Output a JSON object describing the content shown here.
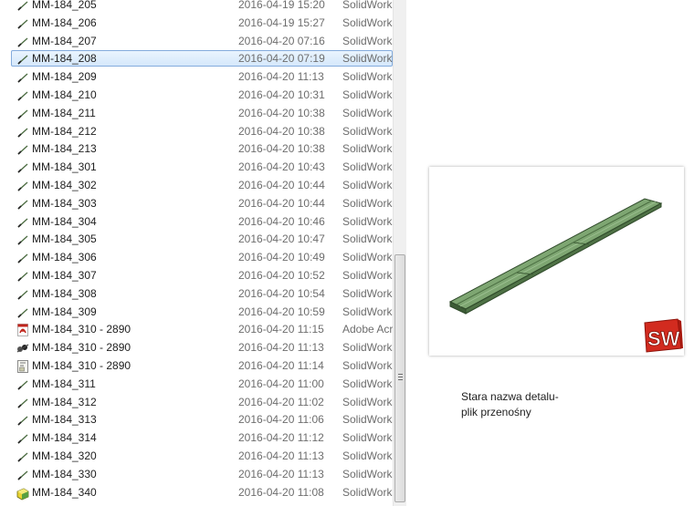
{
  "files": [
    {
      "name": "MM-184_205",
      "date": "2016-04-19 15:20",
      "type": "SolidWorks",
      "icon": "solidworks-part-icon"
    },
    {
      "name": "MM-184_206",
      "date": "2016-04-19 15:27",
      "type": "SolidWorks",
      "icon": "solidworks-part-icon"
    },
    {
      "name": "MM-184_207",
      "date": "2016-04-20 07:16",
      "type": "SolidWorks",
      "icon": "solidworks-part-icon"
    },
    {
      "name": "MM-184_208",
      "date": "2016-04-20 07:19",
      "type": "SolidWorks",
      "icon": "solidworks-part-icon",
      "selected": true
    },
    {
      "name": "MM-184_209",
      "date": "2016-04-20 11:13",
      "type": "SolidWorks",
      "icon": "solidworks-part-icon"
    },
    {
      "name": "MM-184_210",
      "date": "2016-04-20 10:31",
      "type": "SolidWorks",
      "icon": "solidworks-part-icon"
    },
    {
      "name": "MM-184_211",
      "date": "2016-04-20 10:38",
      "type": "SolidWorks",
      "icon": "solidworks-part-icon"
    },
    {
      "name": "MM-184_212",
      "date": "2016-04-20 10:38",
      "type": "SolidWorks",
      "icon": "solidworks-part-icon"
    },
    {
      "name": "MM-184_213",
      "date": "2016-04-20 10:38",
      "type": "SolidWorks",
      "icon": "solidworks-part-icon"
    },
    {
      "name": "MM-184_301",
      "date": "2016-04-20 10:43",
      "type": "SolidWorks",
      "icon": "solidworks-part-icon"
    },
    {
      "name": "MM-184_302",
      "date": "2016-04-20 10:44",
      "type": "SolidWorks",
      "icon": "solidworks-part-icon"
    },
    {
      "name": "MM-184_303",
      "date": "2016-04-20 10:44",
      "type": "SolidWorks",
      "icon": "solidworks-part-icon"
    },
    {
      "name": "MM-184_304",
      "date": "2016-04-20 10:46",
      "type": "SolidWorks",
      "icon": "solidworks-part-icon"
    },
    {
      "name": "MM-184_305",
      "date": "2016-04-20 10:47",
      "type": "SolidWorks",
      "icon": "solidworks-part-icon"
    },
    {
      "name": "MM-184_306",
      "date": "2016-04-20 10:49",
      "type": "SolidWorks",
      "icon": "solidworks-part-icon"
    },
    {
      "name": "MM-184_307",
      "date": "2016-04-20 10:52",
      "type": "SolidWorks",
      "icon": "solidworks-part-icon"
    },
    {
      "name": "MM-184_308",
      "date": "2016-04-20 10:54",
      "type": "SolidWorks",
      "icon": "solidworks-part-icon"
    },
    {
      "name": "MM-184_309",
      "date": "2016-04-20 10:59",
      "type": "SolidWorks",
      "icon": "solidworks-part-icon"
    },
    {
      "name": "MM-184_310 - 2890",
      "date": "2016-04-20 11:15",
      "type": "Adobe Acrobat",
      "icon": "pdf-icon"
    },
    {
      "name": "MM-184_310 - 2890",
      "date": "2016-04-20 11:13",
      "type": "SolidWorks",
      "icon": "solidworks-assembly-icon"
    },
    {
      "name": "MM-184_310 - 2890",
      "date": "2016-04-20 11:14",
      "type": "SolidWorks",
      "icon": "solidworks-drawing-icon"
    },
    {
      "name": "MM-184_311",
      "date": "2016-04-20 11:00",
      "type": "SolidWorks",
      "icon": "solidworks-part-icon"
    },
    {
      "name": "MM-184_312",
      "date": "2016-04-20 11:02",
      "type": "SolidWorks",
      "icon": "solidworks-part-icon"
    },
    {
      "name": "MM-184_313",
      "date": "2016-04-20 11:06",
      "type": "SolidWorks",
      "icon": "solidworks-part-icon"
    },
    {
      "name": "MM-184_314",
      "date": "2016-04-20 11:12",
      "type": "SolidWorks",
      "icon": "solidworks-part-icon"
    },
    {
      "name": "MM-184_320",
      "date": "2016-04-20 11:13",
      "type": "SolidWorks",
      "icon": "solidworks-part-icon"
    },
    {
      "name": "MM-184_330",
      "date": "2016-04-20 11:13",
      "type": "SolidWorks",
      "icon": "solidworks-part-icon"
    },
    {
      "name": "MM-184_340",
      "date": "2016-04-20 11:08",
      "type": "SolidWorks",
      "icon": "solidworks-part-yellow-icon"
    }
  ],
  "preview": {
    "caption_line1": "Stara nazwa detalu-",
    "caption_line2": "plik przenośny",
    "logo_text": "SW",
    "model_color": "#6f9a62",
    "logo_color": "#d22b1f"
  },
  "colors": {
    "selection_fill": "#d9ebfc",
    "selection_border": "#84acdd",
    "meta_text": "#6d6d6d"
  }
}
